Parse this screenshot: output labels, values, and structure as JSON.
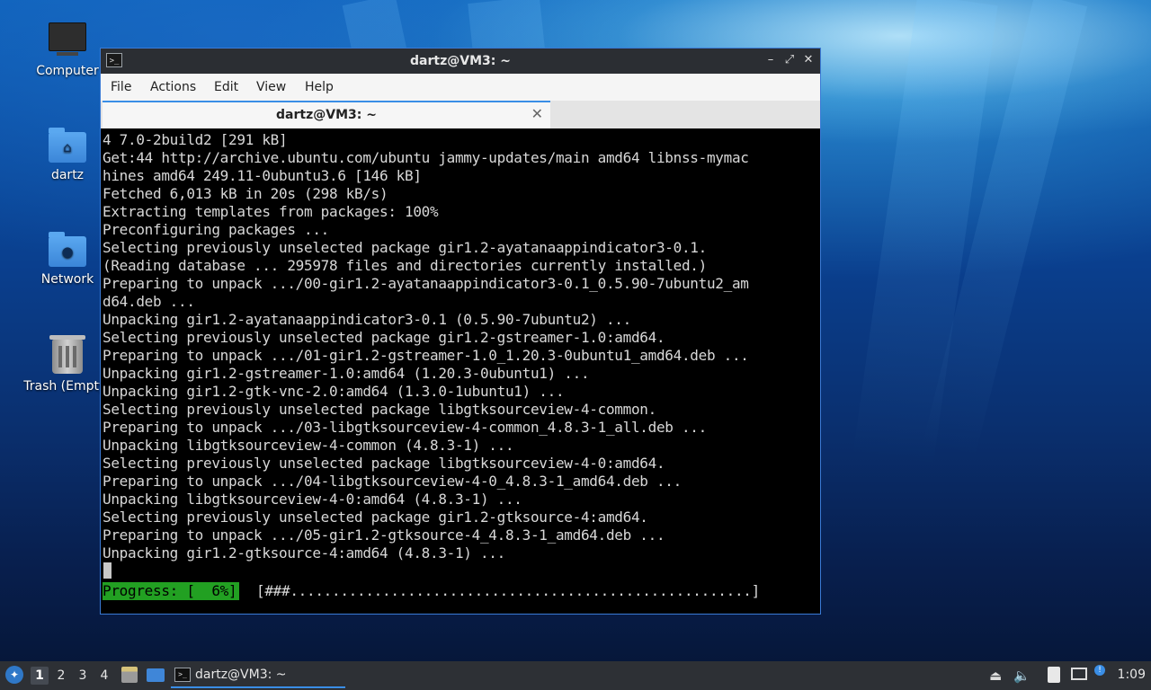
{
  "desktop": {
    "icons": [
      {
        "label": "Computer",
        "icon": "computer-icon"
      },
      {
        "label": "dartz",
        "icon": "home-folder-icon"
      },
      {
        "label": "Network",
        "icon": "network-folder-icon"
      },
      {
        "label": "Trash (Empty)",
        "icon": "trash-icon"
      }
    ]
  },
  "window": {
    "title": "dartz@VM3: ~",
    "controls": [
      "minimize-icon",
      "maximize-icon",
      "close-icon"
    ],
    "menu": [
      "File",
      "Actions",
      "Edit",
      "View",
      "Help"
    ],
    "tab": {
      "label": "dartz@VM3: ~"
    }
  },
  "terminal": {
    "lines": [
      "4 7.0-2build2 [291 kB]",
      "Get:44 http://archive.ubuntu.com/ubuntu jammy-updates/main amd64 libnss-mymac",
      "hines amd64 249.11-0ubuntu3.6 [146 kB]",
      "Fetched 6,013 kB in 20s (298 kB/s)",
      "Extracting templates from packages: 100%",
      "Preconfiguring packages ...",
      "Selecting previously unselected package gir1.2-ayatanaappindicator3-0.1.",
      "(Reading database ... 295978 files and directories currently installed.)",
      "Preparing to unpack .../00-gir1.2-ayatanaappindicator3-0.1_0.5.90-7ubuntu2_am",
      "d64.deb ...",
      "Unpacking gir1.2-ayatanaappindicator3-0.1 (0.5.90-7ubuntu2) ...",
      "Selecting previously unselected package gir1.2-gstreamer-1.0:amd64.",
      "Preparing to unpack .../01-gir1.2-gstreamer-1.0_1.20.3-0ubuntu1_amd64.deb ...",
      "Unpacking gir1.2-gstreamer-1.0:amd64 (1.20.3-0ubuntu1) ...",
      "Unpacking gir1.2-gtk-vnc-2.0:amd64 (1.3.0-1ubuntu1) ...",
      "Selecting previously unselected package libgtksourceview-4-common.",
      "Preparing to unpack .../03-libgtksourceview-4-common_4.8.3-1_all.deb ...",
      "Unpacking libgtksourceview-4-common (4.8.3-1) ...",
      "Selecting previously unselected package libgtksourceview-4-0:amd64.",
      "Preparing to unpack .../04-libgtksourceview-4-0_4.8.3-1_amd64.deb ...",
      "Unpacking libgtksourceview-4-0:amd64 (4.8.3-1) ...",
      "Selecting previously unselected package gir1.2-gtksource-4:amd64.",
      "Preparing to unpack .../05-gir1.2-gtksource-4_4.8.3-1_amd64.deb ...",
      "Unpacking gir1.2-gtksource-4:amd64 (4.8.3-1) ..."
    ],
    "progress_label": "Progress: [  6%]",
    "progress_bar": "[###.......................................................]",
    "progress_fraction": 0.06
  },
  "panel": {
    "workspaces": [
      "1",
      "2",
      "3",
      "4"
    ],
    "active_workspace": "1",
    "task_label": "dartz@VM3: ~",
    "clock": "1:09",
    "tray_icons": [
      "eject-icon",
      "volume-icon",
      "clipboard-icon",
      "network-icon",
      "notification-icon"
    ]
  },
  "colors": {
    "accent": "#3a8ee6",
    "progress_green": "#22a022",
    "panel_bg": "#2d3035"
  }
}
